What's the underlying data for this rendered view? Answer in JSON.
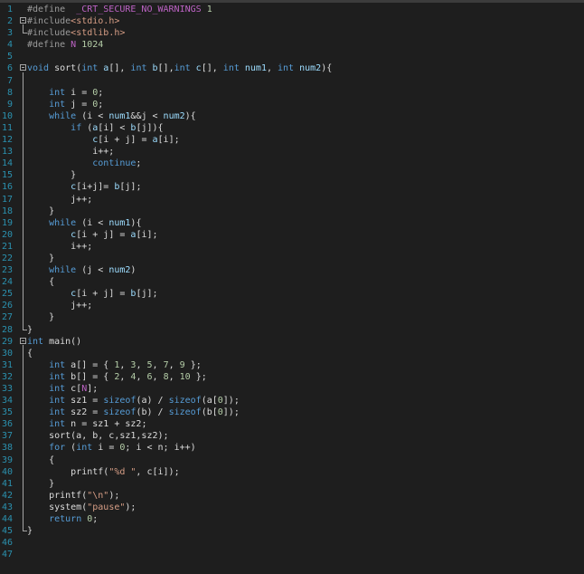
{
  "editor": {
    "lines": [
      {
        "n": "1",
        "tokens": [
          [
            "pp",
            "#define  "
          ],
          [
            "mac",
            "_CRT_SECURE_NO_WARNINGS"
          ],
          [
            "pl",
            " "
          ],
          [
            "num",
            "1"
          ]
        ]
      },
      {
        "n": "2",
        "tokens": [
          [
            "pp",
            "#include"
          ],
          [
            "str",
            "<stdio.h>"
          ]
        ]
      },
      {
        "n": "3",
        "tokens": [
          [
            "pp",
            "#include"
          ],
          [
            "str",
            "<stdlib.h>"
          ]
        ]
      },
      {
        "n": "4",
        "tokens": [
          [
            "pp",
            "#define "
          ],
          [
            "mac",
            "N"
          ],
          [
            "pl",
            " "
          ],
          [
            "num",
            "1024"
          ]
        ]
      },
      {
        "n": "5",
        "tokens": []
      },
      {
        "n": "6",
        "tokens": [
          [
            "kw",
            "void"
          ],
          [
            "pl",
            " sort("
          ],
          [
            "kw",
            "int"
          ],
          [
            "var",
            " a"
          ],
          [
            "pl",
            "[], "
          ],
          [
            "kw",
            "int"
          ],
          [
            "var",
            " b"
          ],
          [
            "pl",
            "[],"
          ],
          [
            "kw",
            "int"
          ],
          [
            "var",
            " c"
          ],
          [
            "pl",
            "[], "
          ],
          [
            "kw",
            "int"
          ],
          [
            "var",
            " num1"
          ],
          [
            "pl",
            ", "
          ],
          [
            "kw",
            "int"
          ],
          [
            "var",
            " num2"
          ],
          [
            "pl",
            "){"
          ]
        ]
      },
      {
        "n": "7",
        "tokens": []
      },
      {
        "n": "8",
        "tokens": [
          [
            "pl",
            "    "
          ],
          [
            "kw",
            "int"
          ],
          [
            "pl",
            " i = "
          ],
          [
            "num",
            "0"
          ],
          [
            "pl",
            ";"
          ]
        ]
      },
      {
        "n": "9",
        "tokens": [
          [
            "pl",
            "    "
          ],
          [
            "kw",
            "int"
          ],
          [
            "pl",
            " j = "
          ],
          [
            "num",
            "0"
          ],
          [
            "pl",
            ";"
          ]
        ]
      },
      {
        "n": "10",
        "tokens": [
          [
            "pl",
            "    "
          ],
          [
            "kw",
            "while"
          ],
          [
            "pl",
            " (i < "
          ],
          [
            "var",
            "num1"
          ],
          [
            "pl",
            "&&j < "
          ],
          [
            "var",
            "num2"
          ],
          [
            "pl",
            "){"
          ]
        ]
      },
      {
        "n": "11",
        "tokens": [
          [
            "pl",
            "        "
          ],
          [
            "kw",
            "if"
          ],
          [
            "pl",
            " ("
          ],
          [
            "var",
            "a"
          ],
          [
            "pl",
            "[i] < "
          ],
          [
            "var",
            "b"
          ],
          [
            "pl",
            "[j]){"
          ]
        ]
      },
      {
        "n": "12",
        "tokens": [
          [
            "pl",
            "            "
          ],
          [
            "var",
            "c"
          ],
          [
            "pl",
            "[i + j] = "
          ],
          [
            "var",
            "a"
          ],
          [
            "pl",
            "[i];"
          ]
        ]
      },
      {
        "n": "13",
        "tokens": [
          [
            "pl",
            "            i++;"
          ]
        ]
      },
      {
        "n": "14",
        "tokens": [
          [
            "pl",
            "            "
          ],
          [
            "kw",
            "continue"
          ],
          [
            "pl",
            ";"
          ]
        ]
      },
      {
        "n": "15",
        "tokens": [
          [
            "pl",
            "        }"
          ]
        ]
      },
      {
        "n": "16",
        "tokens": [
          [
            "pl",
            "        "
          ],
          [
            "var",
            "c"
          ],
          [
            "pl",
            "[i+j]= "
          ],
          [
            "var",
            "b"
          ],
          [
            "pl",
            "[j];"
          ]
        ]
      },
      {
        "n": "17",
        "tokens": [
          [
            "pl",
            "        j++;"
          ]
        ]
      },
      {
        "n": "18",
        "tokens": [
          [
            "pl",
            "    }"
          ]
        ]
      },
      {
        "n": "19",
        "tokens": [
          [
            "pl",
            "    "
          ],
          [
            "kw",
            "while"
          ],
          [
            "pl",
            " (i < "
          ],
          [
            "var",
            "num1"
          ],
          [
            "pl",
            "){"
          ]
        ]
      },
      {
        "n": "20",
        "tokens": [
          [
            "pl",
            "        "
          ],
          [
            "var",
            "c"
          ],
          [
            "pl",
            "[i + j] = "
          ],
          [
            "var",
            "a"
          ],
          [
            "pl",
            "[i];"
          ]
        ]
      },
      {
        "n": "21",
        "tokens": [
          [
            "pl",
            "        i++;"
          ]
        ]
      },
      {
        "n": "22",
        "tokens": [
          [
            "pl",
            "    }"
          ]
        ]
      },
      {
        "n": "23",
        "tokens": [
          [
            "pl",
            "    "
          ],
          [
            "kw",
            "while"
          ],
          [
            "pl",
            " (j < "
          ],
          [
            "var",
            "num2"
          ],
          [
            "pl",
            ")"
          ]
        ]
      },
      {
        "n": "24",
        "tokens": [
          [
            "pl",
            "    {"
          ]
        ]
      },
      {
        "n": "25",
        "tokens": [
          [
            "pl",
            "        "
          ],
          [
            "var",
            "c"
          ],
          [
            "pl",
            "[i + j] = "
          ],
          [
            "var",
            "b"
          ],
          [
            "pl",
            "[j];"
          ]
        ]
      },
      {
        "n": "26",
        "tokens": [
          [
            "pl",
            "        j++;"
          ]
        ]
      },
      {
        "n": "27",
        "tokens": [
          [
            "pl",
            "    }"
          ]
        ]
      },
      {
        "n": "28",
        "tokens": [
          [
            "pl",
            "}"
          ]
        ]
      },
      {
        "n": "29",
        "tokens": [
          [
            "kw",
            "int"
          ],
          [
            "pl",
            " main()"
          ]
        ]
      },
      {
        "n": "30",
        "tokens": [
          [
            "pl",
            "{"
          ]
        ]
      },
      {
        "n": "31",
        "tokens": [
          [
            "pl",
            "    "
          ],
          [
            "kw",
            "int"
          ],
          [
            "pl",
            " a[] = { "
          ],
          [
            "num",
            "1"
          ],
          [
            "pl",
            ", "
          ],
          [
            "num",
            "3"
          ],
          [
            "pl",
            ", "
          ],
          [
            "num",
            "5"
          ],
          [
            "pl",
            ", "
          ],
          [
            "num",
            "7"
          ],
          [
            "pl",
            ", "
          ],
          [
            "num",
            "9"
          ],
          [
            "pl",
            " };"
          ]
        ]
      },
      {
        "n": "32",
        "tokens": [
          [
            "pl",
            "    "
          ],
          [
            "kw",
            "int"
          ],
          [
            "pl",
            " b[] = { "
          ],
          [
            "num",
            "2"
          ],
          [
            "pl",
            ", "
          ],
          [
            "num",
            "4"
          ],
          [
            "pl",
            ", "
          ],
          [
            "num",
            "6"
          ],
          [
            "pl",
            ", "
          ],
          [
            "num",
            "8"
          ],
          [
            "pl",
            ", "
          ],
          [
            "num",
            "10"
          ],
          [
            "pl",
            " };"
          ]
        ]
      },
      {
        "n": "33",
        "tokens": [
          [
            "pl",
            "    "
          ],
          [
            "kw",
            "int"
          ],
          [
            "pl",
            " c["
          ],
          [
            "mac",
            "N"
          ],
          [
            "pl",
            "];"
          ]
        ]
      },
      {
        "n": "34",
        "tokens": [
          [
            "pl",
            "    "
          ],
          [
            "kw",
            "int"
          ],
          [
            "pl",
            " sz1 = "
          ],
          [
            "kw",
            "sizeof"
          ],
          [
            "pl",
            "(a) / "
          ],
          [
            "kw",
            "sizeof"
          ],
          [
            "pl",
            "(a["
          ],
          [
            "num",
            "0"
          ],
          [
            "pl",
            "]);"
          ]
        ]
      },
      {
        "n": "35",
        "tokens": [
          [
            "pl",
            "    "
          ],
          [
            "kw",
            "int"
          ],
          [
            "pl",
            " sz2 = "
          ],
          [
            "kw",
            "sizeof"
          ],
          [
            "pl",
            "(b) / "
          ],
          [
            "kw",
            "sizeof"
          ],
          [
            "pl",
            "(b["
          ],
          [
            "num",
            "0"
          ],
          [
            "pl",
            "]);"
          ]
        ]
      },
      {
        "n": "36",
        "tokens": [
          [
            "pl",
            "    "
          ],
          [
            "kw",
            "int"
          ],
          [
            "pl",
            " n = sz1 + sz2;"
          ]
        ]
      },
      {
        "n": "37",
        "tokens": [
          [
            "pl",
            "    sort(a, b, c,sz1,sz2);"
          ]
        ]
      },
      {
        "n": "38",
        "tokens": [
          [
            "pl",
            "    "
          ],
          [
            "kw",
            "for"
          ],
          [
            "pl",
            " ("
          ],
          [
            "kw",
            "int"
          ],
          [
            "pl",
            " i = "
          ],
          [
            "num",
            "0"
          ],
          [
            "pl",
            "; i < n; i++)"
          ]
        ]
      },
      {
        "n": "39",
        "tokens": [
          [
            "pl",
            "    {"
          ]
        ]
      },
      {
        "n": "40",
        "tokens": [
          [
            "pl",
            "        printf("
          ],
          [
            "str",
            "\"%d \""
          ],
          [
            "pl",
            ", c[i]);"
          ]
        ]
      },
      {
        "n": "41",
        "tokens": [
          [
            "pl",
            "    }"
          ]
        ]
      },
      {
        "n": "42",
        "tokens": [
          [
            "pl",
            "    printf("
          ],
          [
            "str",
            "\"\\n\""
          ],
          [
            "pl",
            ");"
          ]
        ]
      },
      {
        "n": "43",
        "tokens": [
          [
            "pl",
            "    system("
          ],
          [
            "str",
            "\"pause\""
          ],
          [
            "pl",
            ");"
          ]
        ]
      },
      {
        "n": "44",
        "tokens": [
          [
            "pl",
            "    "
          ],
          [
            "kw",
            "return"
          ],
          [
            "pl",
            " "
          ],
          [
            "num",
            "0"
          ],
          [
            "pl",
            ";"
          ]
        ]
      },
      {
        "n": "45",
        "tokens": [
          [
            "pl",
            "}"
          ]
        ]
      },
      {
        "n": "46",
        "tokens": []
      },
      {
        "n": "47",
        "tokens": []
      }
    ],
    "fold_markers": [
      "2",
      "6",
      "29"
    ],
    "colors": {
      "background": "#1e1e1e",
      "line_number": "#2b91af",
      "keyword": "#569cd6",
      "preprocessor": "#9b9b9b",
      "string": "#d69d85",
      "number": "#b5cea8",
      "macro": "#bd63c5"
    }
  }
}
